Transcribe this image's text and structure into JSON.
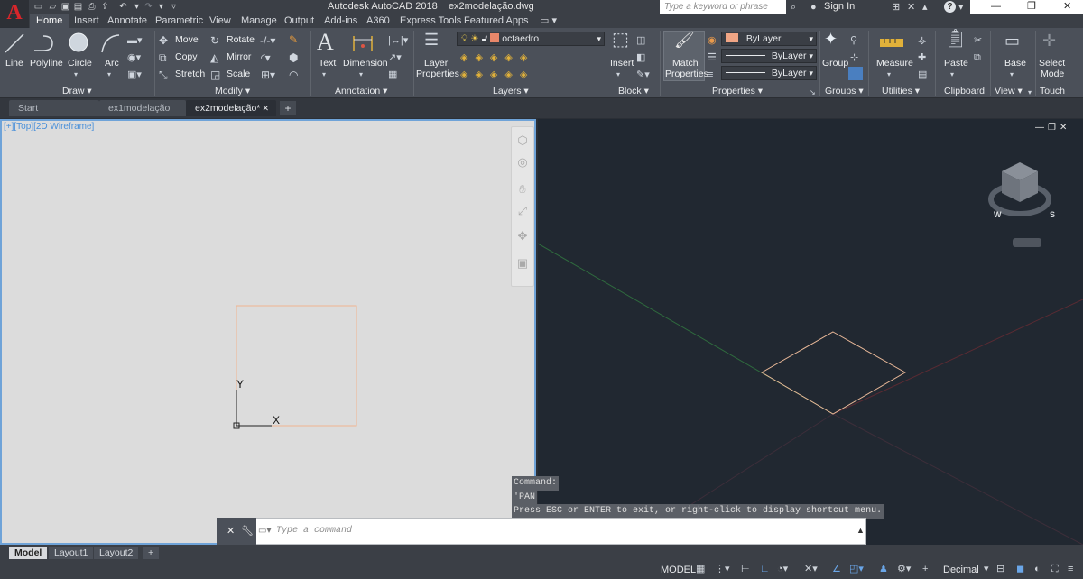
{
  "title_bar": {
    "app_title": "Autodesk AutoCAD 2018",
    "file_title": "ex2modelação.dwg",
    "search_placeholder": "Type a keyword or phrase",
    "sign_in": "Sign In",
    "logo": "A"
  },
  "ribbon_tabs": [
    "Home",
    "Insert",
    "Annotate",
    "Parametric",
    "View",
    "Manage",
    "Output",
    "Add-ins",
    "A360",
    "Express Tools",
    "Featured Apps"
  ],
  "draw_panel": {
    "title": "Draw",
    "line": "Line",
    "polyline": "Polyline",
    "circle": "Circle",
    "arc": "Arc"
  },
  "modify_panel": {
    "title": "Modify",
    "move": "Move",
    "rotate": "Rotate",
    "copy": "Copy",
    "mirror": "Mirror",
    "stretch": "Stretch",
    "scale": "Scale"
  },
  "annotation_panel": {
    "title": "Annotation",
    "text": "Text",
    "dimension": "Dimension"
  },
  "layers_panel": {
    "title": "Layers",
    "layer_properties_l1": "Layer",
    "layer_properties_l2": "Properties",
    "current_layer": "octaedro",
    "layer_color": "#e8876a"
  },
  "block_panel": {
    "title": "Block",
    "insert": "Insert"
  },
  "properties_panel": {
    "title": "Properties",
    "match_l1": "Match",
    "match_l2": "Properties",
    "color": "ByLayer",
    "linetype": "ByLayer",
    "lineweight": "ByLayer"
  },
  "groups_panel": {
    "title": "Groups",
    "group": "Group"
  },
  "utilities_panel": {
    "title": "Utilities",
    "measure": "Measure"
  },
  "clipboard_panel": {
    "title": "Clipboard",
    "paste": "Paste"
  },
  "view_panel": {
    "title": "View",
    "base": "Base"
  },
  "touch_panel": {
    "title": "Touch",
    "select_l1": "Select",
    "select_l2": "Mode"
  },
  "file_tabs": [
    "Start",
    "ex1modelação",
    "ex2modelação*"
  ],
  "viewport_left": {
    "label": "[+][Top][2D Wireframe]",
    "axis_y": "Y",
    "axis_x": "X"
  },
  "viewcube": {
    "west": "W",
    "south": "S"
  },
  "command": {
    "history": [
      "Command:",
      "'PAN",
      "Press ESC or ENTER to exit, or right-click to display shortcut menu."
    ],
    "placeholder": "Type a command"
  },
  "layout_tabs": [
    "Model",
    "Layout1",
    "Layout2"
  ],
  "status": {
    "model": "MODEL",
    "units": "Decimal"
  }
}
